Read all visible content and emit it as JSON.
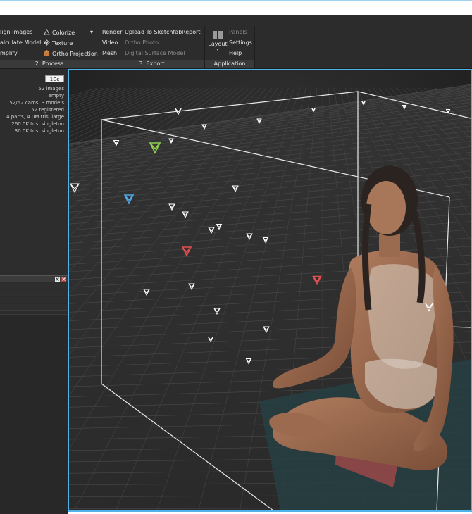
{
  "ribbon": {
    "process": {
      "label": "2. Process",
      "align_images": "lign Images",
      "calculate_model": "alculate Model",
      "simplify": "mplify",
      "colorize": "Colorize",
      "texture": "Texture",
      "ortho_projection": "Ortho Projection"
    },
    "export": {
      "label": "3. Export",
      "render": "Render",
      "upload": "Upload To Sketchfab",
      "report": "Report",
      "video": "Video",
      "ortho_photo": "Ortho Photo",
      "mesh": "Mesh",
      "dsm": "Digital Surface Model"
    },
    "application": {
      "label": "Application",
      "layout": "Layout",
      "panels": "Panels",
      "settings": "Settings",
      "help": "Help"
    }
  },
  "info": {
    "time": "1Ds",
    "lines": [
      "52 images",
      "empty",
      "52/52 cams, 3 models",
      "52 registered",
      "4 parts, 4.0M tris, large",
      "260.0K tris, singleton",
      "30.0K tris, singleton"
    ]
  },
  "colors": {
    "accent": "#4fb3ea",
    "ribbon_bg": "#2c2c2c",
    "camera_selected_green": "#8fd14f",
    "camera_selected_blue": "#4fa8e8",
    "camera_marked_red": "#e05050"
  },
  "viewport": {
    "icons": [
      "camera-icon",
      "bounding-box",
      "reconstructed-model"
    ]
  }
}
